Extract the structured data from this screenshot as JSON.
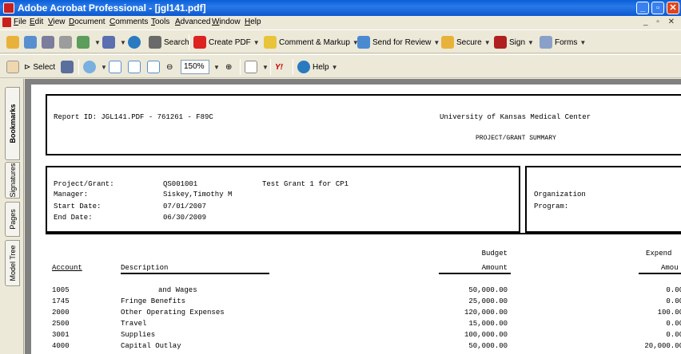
{
  "window": {
    "title": "Adobe Acrobat Professional - [jgl141.pdf]",
    "controls": [
      "_",
      "▫",
      "✕"
    ]
  },
  "menu": [
    "File",
    "Edit",
    "View",
    "Document",
    "Comments",
    "Tools",
    "Advanced",
    "Window",
    "Help"
  ],
  "toolbar1": {
    "search": "Search",
    "create_pdf": "Create PDF",
    "comment_markup": "Comment & Markup",
    "send_review": "Send for Review",
    "secure": "Secure",
    "sign": "Sign",
    "forms": "Forms"
  },
  "toolbar2": {
    "select": "Select",
    "zoom": "150%",
    "help": "Help"
  },
  "nav_tabs": [
    "Bookmarks",
    "Signatures",
    "Pages",
    "Model Tree"
  ],
  "report": {
    "report_id": "Report ID:  JGL141.PDF - 761261 - F89C",
    "institution": "University of Kansas Medical Center",
    "subtitle": "PROJECT/GRANT SUMMARY",
    "fields": {
      "project_label": "Project/Grant:",
      "project_id": "QS001001",
      "project_name": "Test Grant 1 for CP1",
      "manager_label": "Manager:",
      "manager": "Siskey,Timothy M",
      "start_label": "Start Date:",
      "start": "07/01/2007",
      "end_label": "End Date:",
      "end": "06/30/2009",
      "org_label": "Organization",
      "program_label": "Program:"
    },
    "columns": {
      "account": "Account",
      "description": "Description",
      "budget_top": "Budget",
      "budget_bottom": "Amount",
      "expend_top": "Expend",
      "expend_bottom": "Amou"
    },
    "rows": [
      {
        "account": "1005",
        "description": "and Wages",
        "budget": "50,000.00",
        "expend": "0.00"
      },
      {
        "account": "1745",
        "description": "Fringe Benefits",
        "budget": "25,000.00",
        "expend": "0.00"
      },
      {
        "account": "2000",
        "description": "Other Operating Expenses",
        "budget": "120,000.00",
        "expend": "100.00"
      },
      {
        "account": "2500",
        "description": "Travel",
        "budget": "15,000.00",
        "expend": "0.00"
      },
      {
        "account": "3001",
        "description": "Supplies",
        "budget": "100,000.00",
        "expend": "0.00"
      },
      {
        "account": "4000",
        "description": "Capital Outlay",
        "budget": "50,000.00",
        "expend": "20,000.00"
      }
    ]
  }
}
